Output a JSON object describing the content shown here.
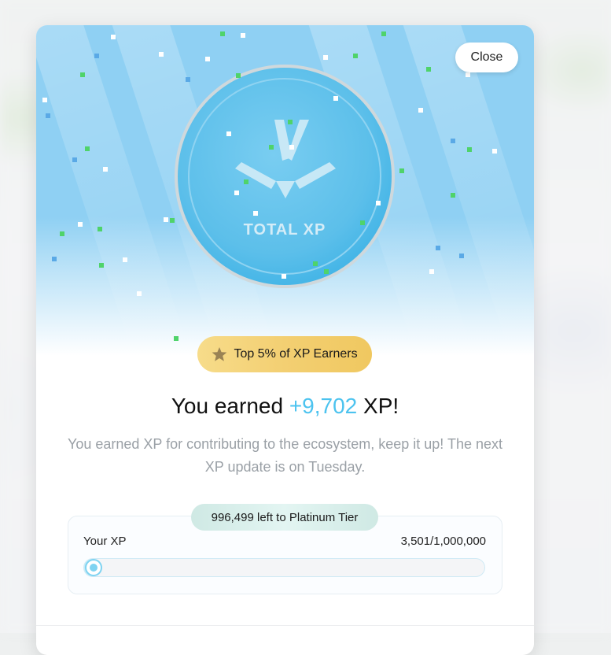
{
  "modal": {
    "close_label": "Close",
    "coin": {
      "label": "TOTAL XP"
    },
    "badge": {
      "icon": "star-icon",
      "label": "Top 5% of XP Earners"
    },
    "headline": {
      "prefix": "You earned",
      "amount": "+9,702",
      "suffix": "XP!"
    },
    "subtext": "You earned XP for contributing to the ecosystem, keep it up! The next XP update is on Tuesday.",
    "progress": {
      "tier_text": "996,499 left to Platinum Tier",
      "label": "Your XP",
      "value_text": "3,501/1,000,000",
      "fraction": 0.0035
    }
  },
  "colors": {
    "accent": "#4cc3ef",
    "hero_sky": "#8fd0f3",
    "coin": "#5cc0ec",
    "badge_gold": "#f3cf72",
    "confetti_green": "#4fd36a"
  }
}
